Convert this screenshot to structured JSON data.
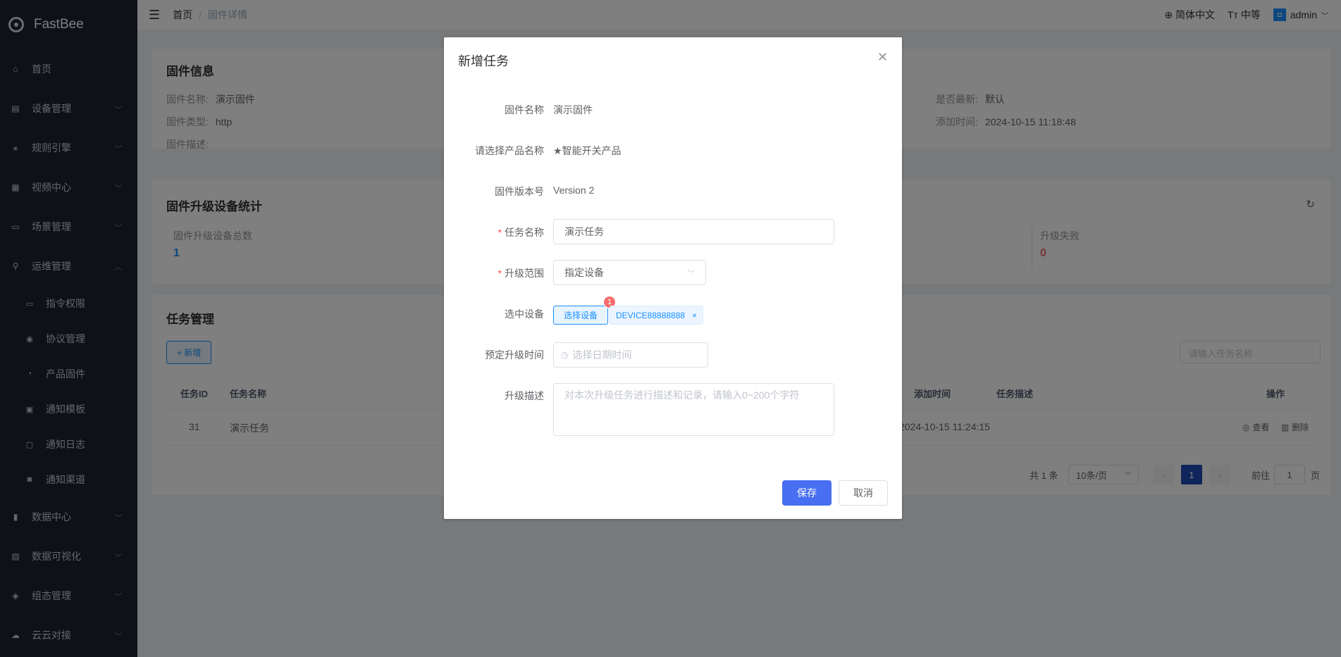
{
  "app": {
    "name": "FastBee"
  },
  "sidebar": {
    "items": [
      {
        "label": "首页",
        "icon": "home-icon"
      },
      {
        "label": "设备管理",
        "icon": "device-icon"
      },
      {
        "label": "规则引擎",
        "icon": "rule-icon"
      },
      {
        "label": "视频中心",
        "icon": "video-icon"
      },
      {
        "label": "场景管理",
        "icon": "scene-icon"
      },
      {
        "label": "运维管理",
        "icon": "ops-icon"
      }
    ],
    "sub_items": [
      {
        "label": "指令权限"
      },
      {
        "label": "协议管理"
      },
      {
        "label": "产品固件"
      },
      {
        "label": "通知模板"
      },
      {
        "label": "通知日志"
      },
      {
        "label": "通知渠道"
      }
    ],
    "bottom_items": [
      {
        "label": "数据中心"
      },
      {
        "label": "数据可视化"
      },
      {
        "label": "组态管理"
      },
      {
        "label": "云云对接"
      }
    ]
  },
  "navbar": {
    "breadcrumb_home": "首页",
    "breadcrumb_current": "固件详情",
    "language": "简体中文",
    "size": "中等",
    "user": "admin"
  },
  "firmware_info": {
    "title": "固件信息",
    "name_label": "固件名称:",
    "name": "演示固件",
    "type_label": "固件类型:",
    "type": "http",
    "desc_label": "固件描述:",
    "latest_label": "是否最新:",
    "latest": "默认",
    "created_label": "添加时间:",
    "created": "2024-10-15 11:18:48"
  },
  "stats": {
    "title": "固件升级设备统计",
    "total_label": "固件升级设备总数",
    "total": "1",
    "failed_label": "升级失败",
    "failed": "0"
  },
  "tasks": {
    "title": "任务管理",
    "add_label": "+ 新增",
    "search_placeholder": "请输入任务名称",
    "columns": {
      "id": "任务ID",
      "name": "任务名称",
      "created": "添加时间",
      "desc": "任务描述",
      "ops": "操作"
    },
    "rows": [
      {
        "id": "31",
        "name": "演示任务",
        "created": "2024-10-15 11:24:15",
        "view": "查看",
        "delete": "删除"
      }
    ],
    "pager": {
      "total": "共 1 条",
      "page_size": "10条/页",
      "current": "1",
      "goto_prefix": "前往",
      "goto_value": "1",
      "goto_suffix": "页"
    }
  },
  "dialog": {
    "title": "新增任务",
    "firmware_name_label": "固件名称",
    "firmware_name": "演示固件",
    "product_label": "请选择产品名称",
    "product": "★智能开关产品",
    "version_label": "固件版本号",
    "version": "Version 2",
    "task_name_label": "任务名称",
    "task_name": "演示任务",
    "scope_label": "升级范围",
    "scope": "指定设备",
    "devices_label": "选中设备",
    "select_device_button": "选择设备",
    "device_count": "1",
    "device_tag": "DEVICE88888888",
    "schedule_label": "预定升级时间",
    "schedule_placeholder": "选择日期时间",
    "desc_label": "升级描述",
    "desc_placeholder": "对本次升级任务进行描述和记录，请输入0~200个字符",
    "save": "保存",
    "cancel": "取消"
  }
}
